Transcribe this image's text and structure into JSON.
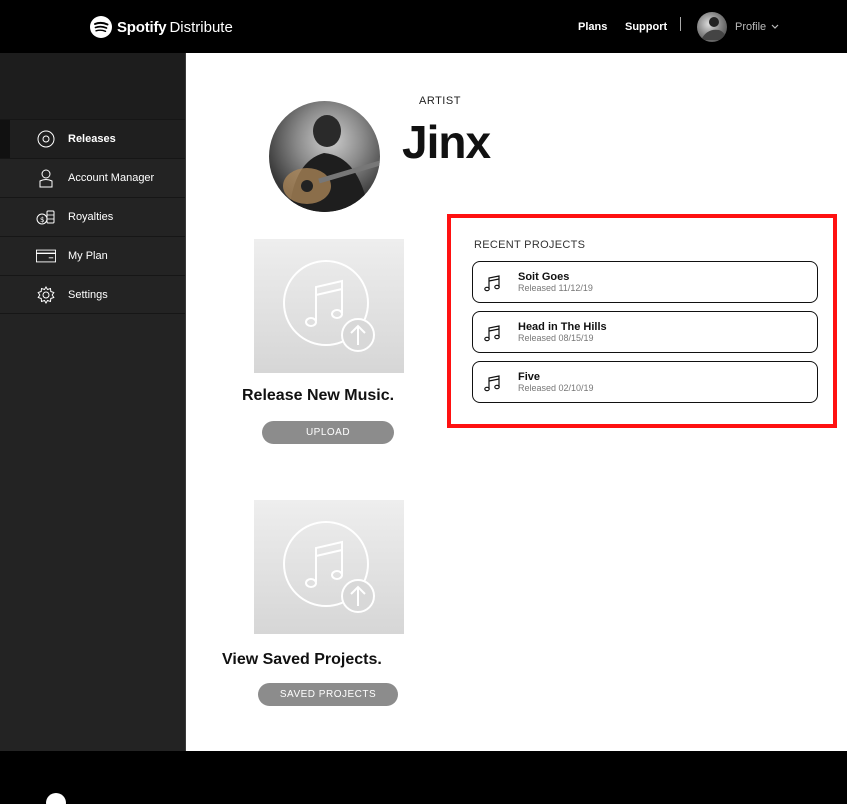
{
  "header": {
    "brand": "Spotify",
    "product": "Distribute",
    "nav": {
      "plans": "Plans",
      "support": "Support",
      "profile": "Profile"
    }
  },
  "sidebar": {
    "items": [
      {
        "label": "Releases",
        "icon": "disc-icon",
        "active": true
      },
      {
        "label": "Account Manager",
        "icon": "user-icon"
      },
      {
        "label": "Royalties",
        "icon": "coins-icon"
      },
      {
        "label": "My Plan",
        "icon": "card-icon"
      },
      {
        "label": "Settings",
        "icon": "gear-icon"
      }
    ]
  },
  "artist": {
    "label": "ARTIST",
    "name": "Jinx"
  },
  "release": {
    "title": "Release New Music.",
    "button": "UPLOAD"
  },
  "saved": {
    "title": "View Saved Projects.",
    "button": "SAVED PROJECTS"
  },
  "recent": {
    "title": "RECENT PROJECTS",
    "projects": [
      {
        "name": "Soit Goes",
        "date": "Released 11/12/19"
      },
      {
        "name": "Head in The Hills",
        "date": "Released 08/15/19"
      },
      {
        "name": "Five",
        "date": "Released 02/10/19"
      }
    ]
  },
  "colors": {
    "highlight": "#ff1111",
    "topbar": "#000000",
    "sidebar": "#232323",
    "pill": "#8c8c8c"
  }
}
